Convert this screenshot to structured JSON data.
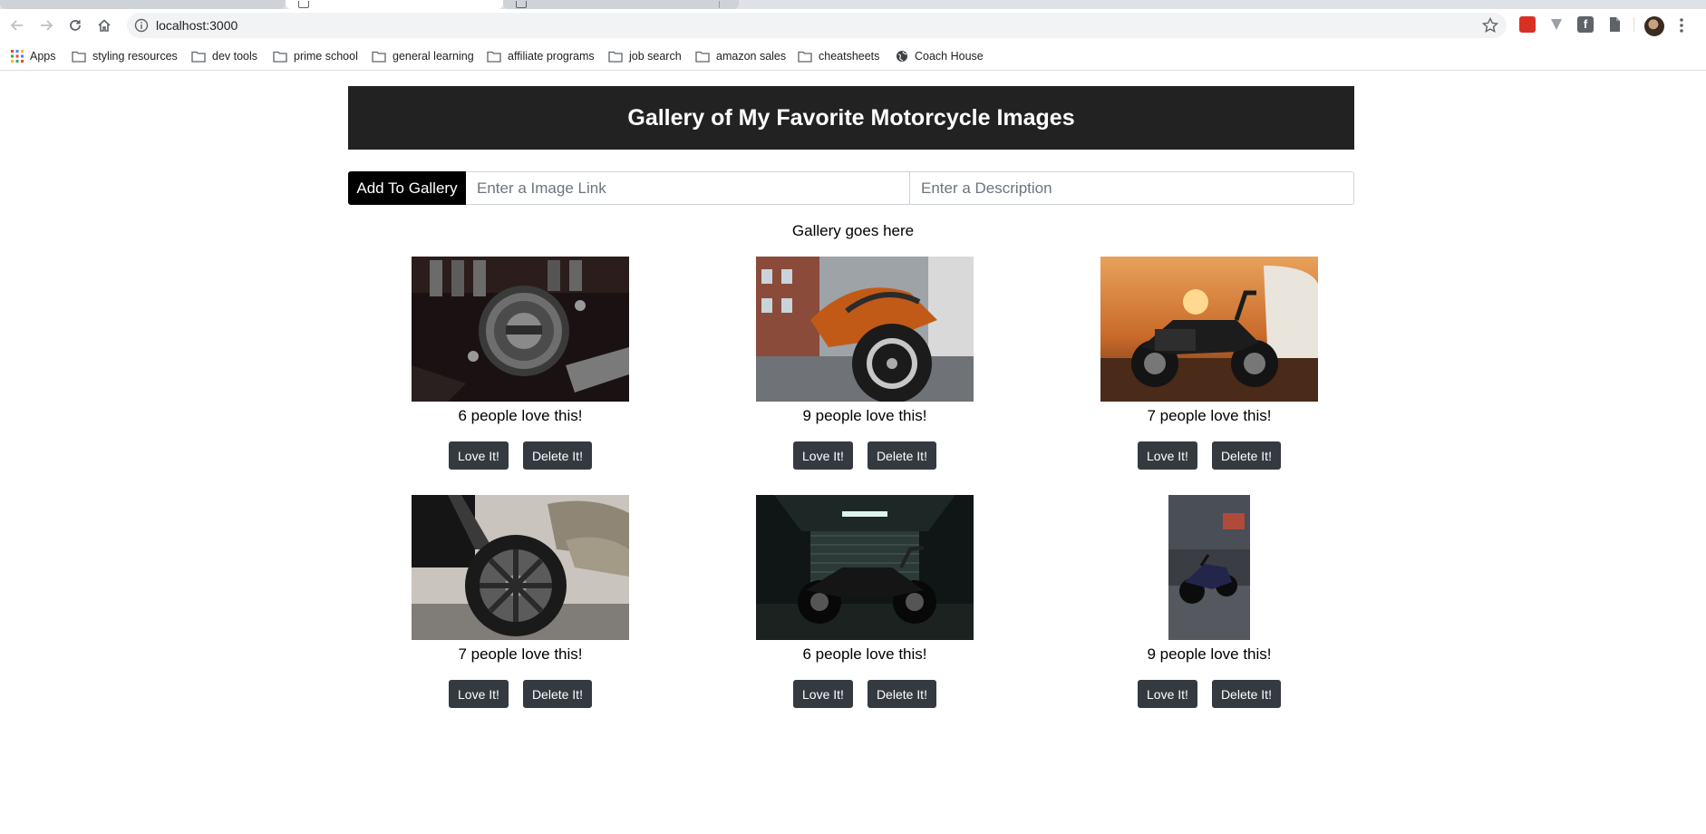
{
  "browser": {
    "url": "localhost:3000",
    "bookmarks": [
      {
        "label": "Apps",
        "icon": "apps-grid-icon"
      },
      {
        "label": "styling resources",
        "icon": "folder-icon"
      },
      {
        "label": "dev tools",
        "icon": "folder-icon"
      },
      {
        "label": "prime school",
        "icon": "folder-icon"
      },
      {
        "label": "general learning",
        "icon": "folder-icon"
      },
      {
        "label": "affiliate programs",
        "icon": "folder-icon"
      },
      {
        "label": "job search",
        "icon": "folder-icon"
      },
      {
        "label": "amazon sales",
        "icon": "folder-icon"
      },
      {
        "label": "cheatsheets",
        "icon": "folder-icon"
      },
      {
        "label": "Coach House",
        "icon": "globe-icon"
      }
    ]
  },
  "app": {
    "title": "Gallery of My Favorite Motorcycle Images",
    "add_button": "Add To Gallery",
    "link_placeholder": "Enter a Image Link",
    "description_placeholder": "Enter a Description",
    "gallery_heading": "Gallery goes here",
    "love_label": "Love It!",
    "delete_label": "Delete It!"
  },
  "gallery": [
    {
      "love_text": "6 people love this!",
      "image": "engine-closeup-photo"
    },
    {
      "love_text": "9 people love this!",
      "image": "orange-bike-street-photo"
    },
    {
      "love_text": "7 people love this!",
      "image": "sunset-bike-photo"
    },
    {
      "love_text": "7 people love this!",
      "image": "front-wheel-photo"
    },
    {
      "love_text": "6 people love this!",
      "image": "garage-bike-photo"
    },
    {
      "love_text": "9 people love this!",
      "image": "parking-bike-photo"
    }
  ],
  "colors": {
    "header_bg": "#222222",
    "button_bg": "#343a40",
    "add_button_bg": "#000000"
  }
}
